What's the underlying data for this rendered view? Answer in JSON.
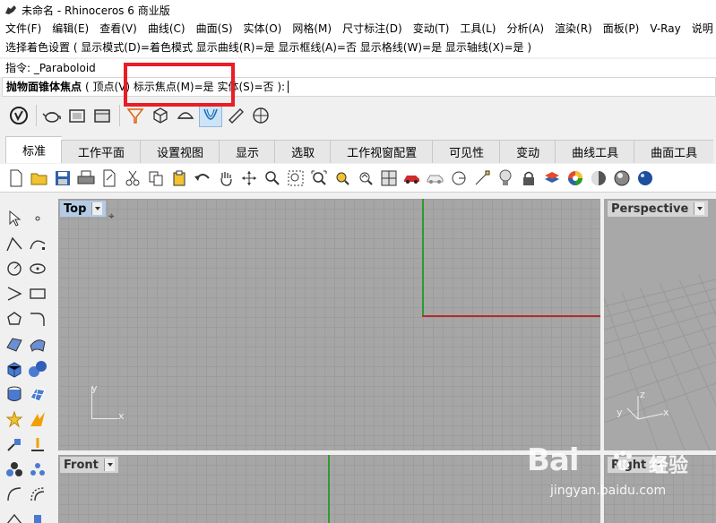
{
  "window": {
    "title": "未命名 - Rhinoceros 6 商业版"
  },
  "menu": [
    "文件(F)",
    "编辑(E)",
    "查看(V)",
    "曲线(C)",
    "曲面(S)",
    "实体(O)",
    "网格(M)",
    "尺寸标注(D)",
    "变动(T)",
    "工具(L)",
    "分析(A)",
    "渲染(R)",
    "面板(P)",
    "V-Ray",
    "说明"
  ],
  "command": {
    "history": "选择着色设置 ( 显示模式(D)=着色模式  显示曲线(R)=是  显示框线(A)=否  显示格线(W)=是  显示轴线(X)=是 )",
    "prompt": "指令: _Paraboloid",
    "input_label": "抛物面锥体焦点",
    "input_options": "( 顶点(V)   标示焦点(M)=是  实体(S)=否 ):"
  },
  "tabs": [
    "标准",
    "工作平面",
    "设置视图",
    "显示",
    "选取",
    "工作视窗配置",
    "可见性",
    "变动",
    "曲线工具",
    "曲面工具"
  ],
  "active_tab": "标准",
  "viewports": {
    "top": {
      "title": "Top",
      "x_label": "x",
      "y_label": "y"
    },
    "perspective": {
      "title": "Perspective",
      "x_label": "x",
      "y_label": "y",
      "z_label": "z"
    },
    "front": {
      "title": "Front"
    },
    "right": {
      "title": "Right"
    }
  },
  "watermark": {
    "logo": "Bai",
    "brand": "经验",
    "url": "jingyan.baidu.com"
  },
  "colors": {
    "highlight": "#ea1c24",
    "y_axis": "#2e9b2e",
    "x_axis": "#b22c2c",
    "active_viewport_title": "#b4cbe5"
  }
}
